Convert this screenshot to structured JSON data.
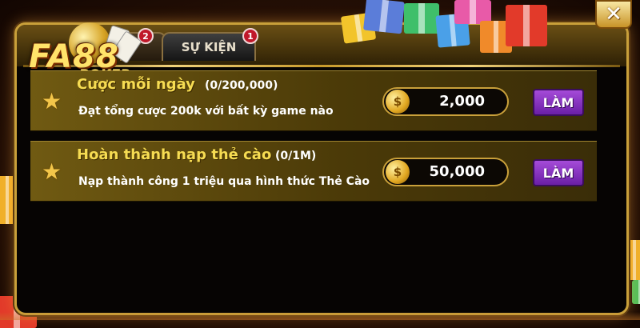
{
  "logo": {
    "main": "FA88",
    "sub": ".POKER"
  },
  "tabs": [
    {
      "label": "",
      "badge": "2"
    },
    {
      "label": "SỰ KIỆN",
      "badge": "1"
    }
  ],
  "close": {
    "glyph": "✕"
  },
  "tasks": [
    {
      "title": "Cược mỗi ngày",
      "progress": "(0/200,000)",
      "description": "Đạt tổng cược 200k với bất kỳ game nào",
      "reward": "2,000",
      "button": "LÀM"
    },
    {
      "title": "Hoàn thành nạp thẻ cào",
      "progress": "(0/1M)",
      "description": "Nạp thành công 1 triệu qua hình thức Thẻ Cào",
      "reward": "50,000",
      "button": "LÀM"
    }
  ],
  "icons": {
    "star": "star-icon",
    "coin": "coin-icon",
    "close": "close-icon",
    "gift": "gift-box-icon"
  },
  "colors": {
    "gold": "#c9a03a",
    "title": "#f6dc52",
    "button": "#8a35c0",
    "badge": "#c0182a"
  }
}
